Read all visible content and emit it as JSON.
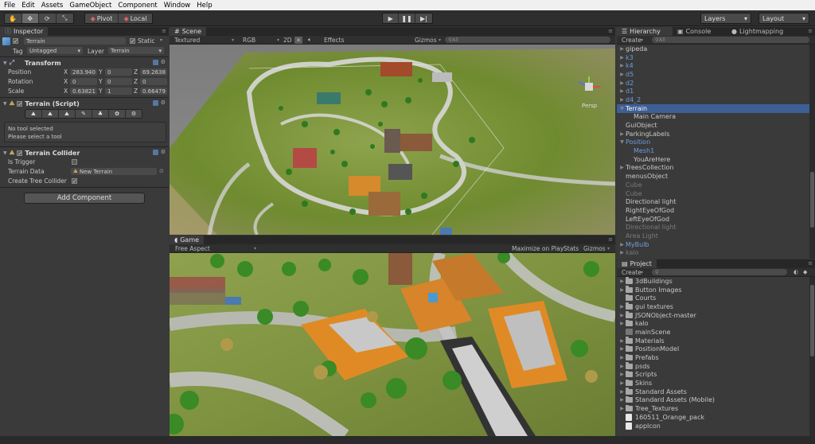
{
  "menu": [
    "File",
    "Edit",
    "Assets",
    "GameObject",
    "Component",
    "Window",
    "Help"
  ],
  "toolbar": {
    "tools": [
      "hand-icon",
      "move-icon",
      "rotate-icon",
      "scale-icon"
    ],
    "pivot_label": "Pivot",
    "local_label": "Local",
    "play": [
      "play-icon",
      "pause-icon",
      "step-icon"
    ],
    "layers_label": "Layers",
    "layout_label": "Layout"
  },
  "inspector": {
    "tab": "Inspector",
    "object_name": "Terrain",
    "static_label": "Static",
    "tag_label": "Tag",
    "tag_value": "Untagged",
    "layer_label": "Layer",
    "layer_value": "Terrain",
    "transform": {
      "title": "Transform",
      "position": {
        "label": "Position",
        "x": "283.940",
        "y": "0",
        "z": "69.2638"
      },
      "rotation": {
        "label": "Rotation",
        "x": "0",
        "y": "0",
        "z": "0"
      },
      "scale": {
        "label": "Scale",
        "x": "0.63821",
        "y": "1",
        "z": "0.66479"
      }
    },
    "terrain_script": {
      "title": "Terrain (Script)",
      "no_tool": "No tool selected",
      "hint": "Please select a tool"
    },
    "terrain_collider": {
      "title": "Terrain Collider",
      "is_trigger": "Is Trigger",
      "terrain_data": "Terrain Data",
      "terrain_data_value": "New Terrain",
      "create_tree_collider": "Create Tree Collider"
    },
    "add_component": "Add Component"
  },
  "scene": {
    "tab": "Scene",
    "draw_mode": "Textured",
    "render_mode": "RGB",
    "mode_2d": "2D",
    "effects": "Effects",
    "gizmos": "Gizmos",
    "search_placeholder": "All",
    "persp_label": "Persp"
  },
  "game": {
    "tab": "Game",
    "aspect": "Free Aspect",
    "maximize": "Maximize on Play",
    "stats": "Stats",
    "gizmos": "Gizmos"
  },
  "hierarchy": {
    "tabs": [
      "Hierarchy",
      "Console",
      "Lightmapping"
    ],
    "create": "Create",
    "search_placeholder": "All",
    "items": [
      {
        "label": "gipeda",
        "indent": 0,
        "arrow": true,
        "style": "normal"
      },
      {
        "label": "k3",
        "indent": 0,
        "arrow": true,
        "style": "blue"
      },
      {
        "label": "k4",
        "indent": 0,
        "arrow": true,
        "style": "blue"
      },
      {
        "label": "d5",
        "indent": 0,
        "arrow": true,
        "style": "blue"
      },
      {
        "label": "d2",
        "indent": 0,
        "arrow": true,
        "style": "blue"
      },
      {
        "label": "d1",
        "indent": 0,
        "arrow": true,
        "style": "blue"
      },
      {
        "label": "d4_2",
        "indent": 0,
        "arrow": true,
        "style": "blue"
      },
      {
        "label": "Terrain",
        "indent": 0,
        "arrow": true,
        "open": true,
        "style": "sel"
      },
      {
        "label": "Main Camera",
        "indent": 1,
        "arrow": false,
        "style": "normal"
      },
      {
        "label": "GuiObject",
        "indent": 0,
        "arrow": false,
        "style": "normal"
      },
      {
        "label": "ParkingLabels",
        "indent": 0,
        "arrow": true,
        "style": "normal"
      },
      {
        "label": "Position",
        "indent": 0,
        "arrow": true,
        "open": true,
        "style": "blue"
      },
      {
        "label": "Mesh1",
        "indent": 1,
        "arrow": false,
        "style": "blue"
      },
      {
        "label": "YouAreHere",
        "indent": 1,
        "arrow": false,
        "style": "normal"
      },
      {
        "label": "TreesCollection",
        "indent": 0,
        "arrow": true,
        "style": "normal"
      },
      {
        "label": "menusObject",
        "indent": 0,
        "arrow": false,
        "style": "normal"
      },
      {
        "label": "Cube",
        "indent": 0,
        "arrow": false,
        "style": "grey"
      },
      {
        "label": "Cube",
        "indent": 0,
        "arrow": false,
        "style": "grey"
      },
      {
        "label": "Directional light",
        "indent": 0,
        "arrow": false,
        "style": "normal"
      },
      {
        "label": "RightEyeOfGod",
        "indent": 0,
        "arrow": false,
        "style": "normal"
      },
      {
        "label": "LeftEyeOfGod",
        "indent": 0,
        "arrow": false,
        "style": "normal"
      },
      {
        "label": "Directional light",
        "indent": 0,
        "arrow": false,
        "style": "grey"
      },
      {
        "label": "Area Light",
        "indent": 0,
        "arrow": false,
        "style": "grey"
      },
      {
        "label": "MyBulb",
        "indent": 0,
        "arrow": true,
        "style": "blue"
      },
      {
        "label": "kalo",
        "indent": 0,
        "arrow": true,
        "style": "grey"
      }
    ]
  },
  "project": {
    "tab": "Project",
    "create": "Create",
    "items": [
      {
        "label": "3dBuildings",
        "type": "folder",
        "arrow": true
      },
      {
        "label": "Button Images",
        "type": "folder",
        "arrow": true
      },
      {
        "label": "Courts",
        "type": "folder",
        "arrow": false
      },
      {
        "label": "gui textures",
        "type": "folder",
        "arrow": true
      },
      {
        "label": "JSONObject-master",
        "type": "folder",
        "arrow": true
      },
      {
        "label": "kalo",
        "type": "folder",
        "arrow": true
      },
      {
        "label": "mainScene",
        "type": "scene",
        "arrow": false
      },
      {
        "label": "Materials",
        "type": "folder",
        "arrow": true
      },
      {
        "label": "PositionModel",
        "type": "folder",
        "arrow": true
      },
      {
        "label": "Prefabs",
        "type": "folder",
        "arrow": true
      },
      {
        "label": "psds",
        "type": "folder",
        "arrow": true
      },
      {
        "label": "Scripts",
        "type": "folder",
        "arrow": true
      },
      {
        "label": "Skins",
        "type": "folder",
        "arrow": true
      },
      {
        "label": "Standard Assets",
        "type": "folder",
        "arrow": true
      },
      {
        "label": "Standard Assets (Mobile)",
        "type": "folder",
        "arrow": true
      },
      {
        "label": "Tree_Textures",
        "type": "folder",
        "arrow": true
      },
      {
        "label": "160511_Orange_pack",
        "type": "file",
        "arrow": false
      },
      {
        "label": "appIcon",
        "type": "file",
        "arrow": false
      }
    ]
  },
  "colors": {
    "selection": "#3e5f96",
    "blue_text": "#6f9de0",
    "panel": "#3a3a3a",
    "accent_orange": "#d58a2c"
  }
}
